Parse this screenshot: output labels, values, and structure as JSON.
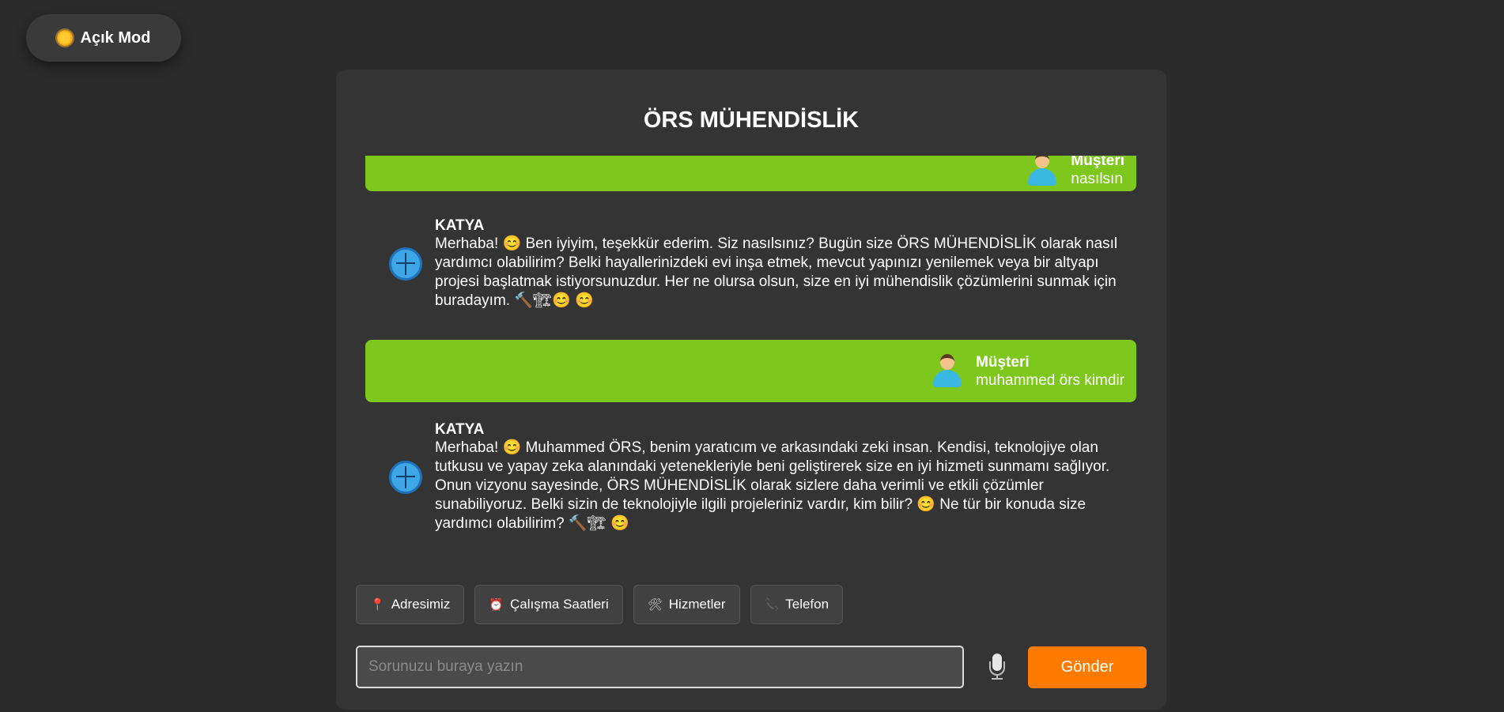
{
  "mode_toggle": {
    "label": "Açık Mod",
    "icon": "sun-icon"
  },
  "header": {
    "title": "ÖRS MÜHENDİSLİK"
  },
  "messages": [
    {
      "sender": "Müşteri",
      "text": "nasılsın"
    },
    {
      "sender": "KATYA",
      "text": "Merhaba! 😊 Ben iyiyim, teşekkür ederim. Siz nasılsınız? Bugün size ÖRS MÜHENDİSLİK olarak nasıl yardımcı olabilirim? Belki hayallerinizdeki evi inşa etmek, mevcut yapınızı yenilemek veya bir altyapı projesi başlatmak istiyorsunuzdur. Her ne olursa olsun, size en iyi mühendislik çözümlerini sunmak için buradayım. 🔨🏗😊 😊"
    },
    {
      "sender": "Müşteri",
      "text": "muhammed örs kimdir"
    },
    {
      "sender": "KATYA",
      "text": "Merhaba! 😊 Muhammed ÖRS, benim yaratıcım ve arkasındaki zeki insan. Kendisi, teknolojiye olan tutkusu ve yapay zeka alanındaki yetenekleriyle beni geliştirerek size en iyi hizmeti sunmamı sağlıyor. Onun vizyonu sayesinde, ÖRS MÜHENDİSLİK olarak sizlere daha verimli ve etkili çözümler sunabiliyoruz. Belki sizin de teknolojiyle ilgili projeleriniz vardır, kim bilir? 😊 Ne tür bir konuda size yardımcı olabilirim? 🔨🏗 😊"
    }
  ],
  "quick_replies": [
    {
      "label": "Adresimiz",
      "icon": "📍"
    },
    {
      "label": "Çalışma Saatleri",
      "icon": "⏰"
    },
    {
      "label": "Hizmetler",
      "icon": "🛠"
    },
    {
      "label": "Telefon",
      "icon": "📞"
    }
  ],
  "input": {
    "placeholder": "Sorunuzu buraya yazın",
    "value": ""
  },
  "send_button": {
    "label": "Gönder"
  },
  "colors": {
    "user_bubble": "#7ec81d",
    "send": "#ff7b00",
    "panel": "#343434",
    "background": "#2b2b2b"
  }
}
